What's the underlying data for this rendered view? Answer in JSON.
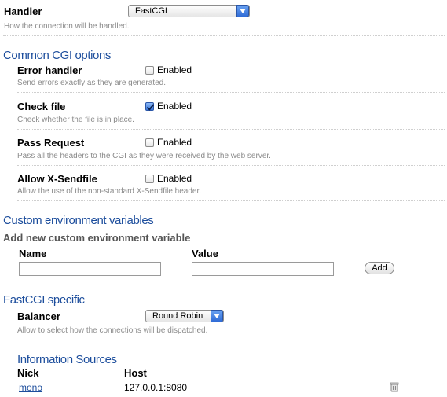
{
  "handler": {
    "label": "Handler",
    "selected": "FastCGI",
    "help": "How the connection will be handled."
  },
  "common_cgi": {
    "title": "Common CGI options",
    "options": [
      {
        "label": "Error handler",
        "checkbox_label": "Enabled",
        "checked": false,
        "help": "Send errors exactly as they are generated."
      },
      {
        "label": "Check file",
        "checkbox_label": "Enabled",
        "checked": true,
        "help": "Check whether the file is in place."
      },
      {
        "label": "Pass Request",
        "checkbox_label": "Enabled",
        "checked": false,
        "help": "Pass all the headers to the CGI as they were received by the web server."
      },
      {
        "label": "Allow X-Sendfile",
        "checkbox_label": "Enabled",
        "checked": false,
        "help": "Allow the use of the non-standard X-Sendfile header."
      }
    ]
  },
  "custom_env": {
    "title": "Custom environment variables",
    "subtitle": "Add new custom environment variable",
    "name_label": "Name",
    "value_label": "Value",
    "name_value": "",
    "value_value": "",
    "add_label": "Add"
  },
  "fastcgi": {
    "title": "FastCGI specific",
    "balancer_label": "Balancer",
    "balancer_selected": "Round Robin",
    "balancer_help": "Allow to select how the connections will be dispatched."
  },
  "info_sources": {
    "title": "Information Sources",
    "columns": [
      "Nick",
      "Host"
    ],
    "rows": [
      {
        "nick": "mono",
        "host": "127.0.0.1:8080",
        "action_icon": "delete-icon"
      }
    ]
  }
}
